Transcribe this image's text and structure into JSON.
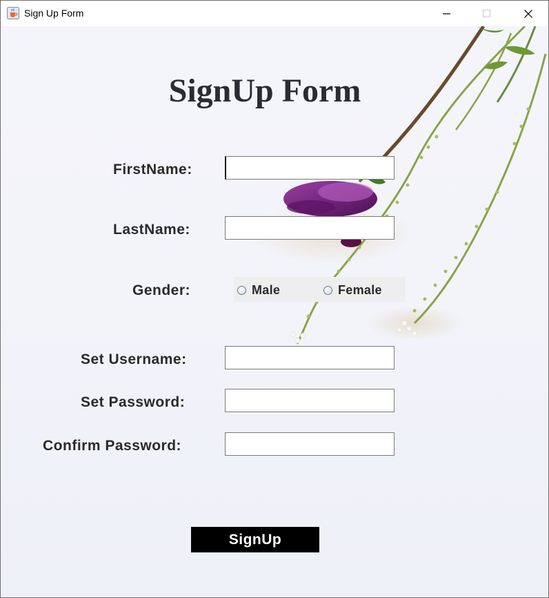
{
  "window": {
    "title": "Sign Up Form",
    "app_icon": "java-cup-icon",
    "controls": [
      "minimize-icon",
      "maximize-icon",
      "close-icon"
    ]
  },
  "form": {
    "heading": "SignUp Form",
    "fields": {
      "first_name": {
        "label": "FirstName:",
        "value": ""
      },
      "last_name": {
        "label": "LastName:",
        "value": ""
      },
      "gender": {
        "label": "Gender:",
        "options": [
          "Male",
          "Female"
        ],
        "selected": null
      },
      "username": {
        "label": "Set Username:",
        "value": ""
      },
      "password": {
        "label": "Set Password:",
        "value": ""
      },
      "confirm_password": {
        "label": "Confirm Password:",
        "value": ""
      }
    },
    "submit_label": "SignUp"
  },
  "colors": {
    "button_bg": "#000000",
    "button_text": "#ffffff",
    "label_text": "#2a2a2a",
    "background": "#f3f4fa",
    "flower": "#7a1f7e"
  }
}
